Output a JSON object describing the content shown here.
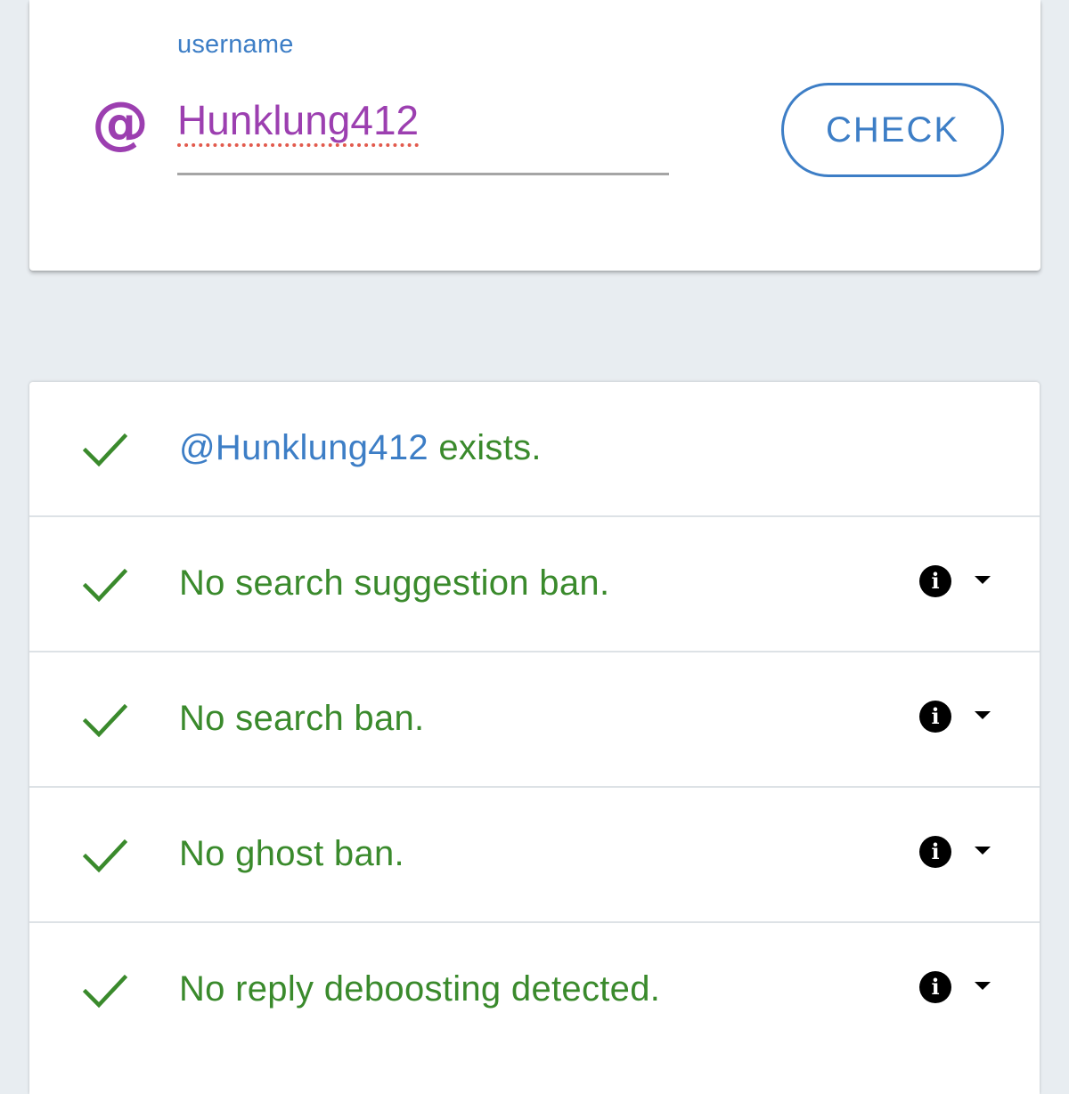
{
  "form": {
    "label": "username",
    "prefix_icon": "at-sign-icon",
    "username_value": "Hunklung412",
    "check_label": "CHECK"
  },
  "results": [
    {
      "status": "pass",
      "mention": "@Hunklung412",
      "text": " exists.",
      "has_info": false
    },
    {
      "status": "pass",
      "text": "No search suggestion ban.",
      "has_info": true
    },
    {
      "status": "pass",
      "text": "No search ban.",
      "has_info": true
    },
    {
      "status": "pass",
      "text": "No ghost ban.",
      "has_info": true
    },
    {
      "status": "pass",
      "text": "No reply deboosting detected.",
      "has_info": true
    }
  ],
  "colors": {
    "accent_blue": "#3d7ec6",
    "purple": "#9c3fb0",
    "success_green": "#3a8a2c",
    "background": "#e8edf1"
  }
}
